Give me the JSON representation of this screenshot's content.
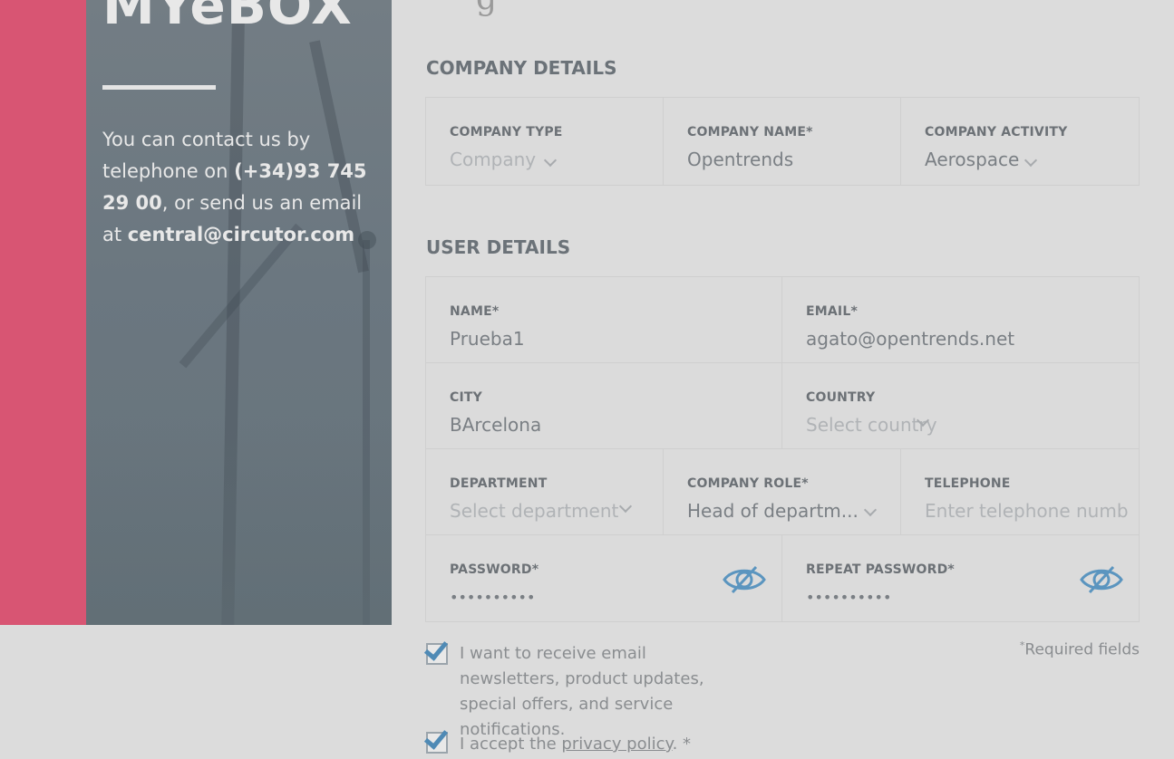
{
  "sidebar": {
    "brand": "MYeBOX",
    "contact_prefix": "You can contact us by telephone on ",
    "phone": "(+34)93 745 29 00",
    "contact_mid": ", or send us an email at ",
    "email": "central@circutor.com"
  },
  "header": {
    "title_fragment": "g"
  },
  "company_section": {
    "title": "COMPANY DETAILS",
    "fields": {
      "type": {
        "label": "COMPANY TYPE",
        "value": "Company"
      },
      "name": {
        "label": "COMPANY NAME*",
        "value": "Opentrends"
      },
      "activity": {
        "label": "COMPANY ACTIVITY",
        "value": "Aerospace"
      }
    }
  },
  "user_section": {
    "title": "USER DETAILS",
    "fields": {
      "name": {
        "label": "NAME*",
        "value": "Prueba1"
      },
      "email": {
        "label": "EMAIL*",
        "value": "agato@opentrends.net"
      },
      "city": {
        "label": "CITY",
        "value": "BArcelona"
      },
      "country": {
        "label": "COUNTRY",
        "placeholder": "Select country"
      },
      "department": {
        "label": "DEPARTMENT",
        "placeholder": "Select department"
      },
      "role": {
        "label": "COMPANY ROLE*",
        "value": "Head of departm..."
      },
      "telephone": {
        "label": "TELEPHONE",
        "placeholder": "Enter telephone numb"
      },
      "password": {
        "label": "PASSWORD*",
        "value": "••••••••••"
      },
      "repeat_password": {
        "label": "REPEAT PASSWORD*",
        "value": "••••••••••"
      }
    }
  },
  "consents": {
    "newsletter": {
      "checked": true,
      "text": "I want to receive email newsletters, product updates, special offers, and service notifications."
    },
    "privacy": {
      "checked": true,
      "prefix": "I accept the ",
      "link": "privacy policy",
      "suffix": ". *"
    }
  },
  "required_note": {
    "mark": "*",
    "text": "Required fields"
  },
  "colors": {
    "accent_pink": "#d85573",
    "check_blue": "#4f8ab5",
    "eye_blue": "#5b95bf"
  },
  "icons": {
    "dropdown": "chevron-down-icon",
    "password_toggle": "eye-slash-icon",
    "checkbox": "checkmark-icon"
  }
}
